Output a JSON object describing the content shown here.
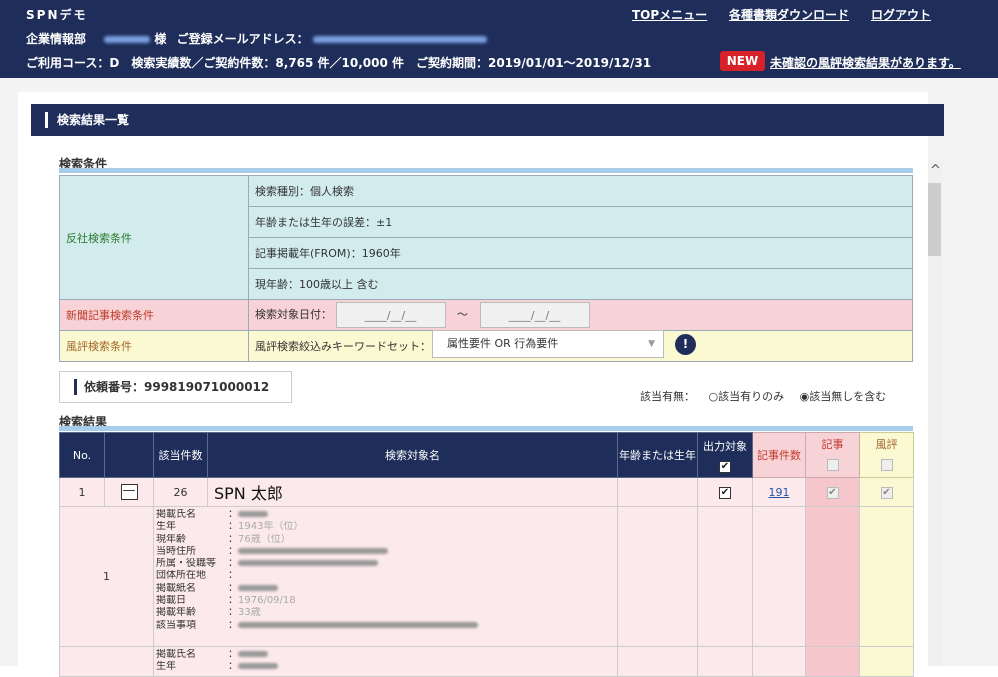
{
  "header": {
    "app_title": "SPNデモ",
    "nav": [
      "TOPメニュー",
      "各種書類ダウンロード",
      "ログアウト"
    ],
    "company_label": "企業情報部",
    "name_suffix": "様",
    "email_label": "ご登録メールアドレス：",
    "email_value": "kj-demo@sp-network.co.jp",
    "course_line": "ご利用コース：D　検索実績数／ご契約件数：8,765 件／10,000 件　ご契約期間：2019/01/01～2019/12/31",
    "new_badge": "NEW",
    "notice": "未確認の風評検索結果があります。"
  },
  "panel": {
    "title": "検索結果一覧"
  },
  "conditions": {
    "section": "検索条件",
    "anti_label": "反社検索条件",
    "anti_rows": [
      "検索種別：個人検索",
      "年齢または生年の誤差：±1",
      "記事掲載年(FROM)：1960年",
      "現年齢：100歳以上 含む"
    ],
    "news_label": "新聞記事検索条件",
    "news_date_label": "検索対象日付：",
    "date_placeholder": "____/__/__",
    "tilde": "～",
    "reputation_label": "風評検索条件",
    "keyword_label": "風評検索絞込みキーワードセット：",
    "keyword_value": "属性要件 OR 行為要件",
    "info_icon": "!"
  },
  "request": {
    "label": "依頼番号：999819071000012"
  },
  "filter": {
    "label": "該当有無：",
    "opt1": "○該当有りのみ",
    "opt2": "◉該当無しを含む"
  },
  "results": {
    "section": "検索結果",
    "headers": {
      "no": "No.",
      "count": "該当件数",
      "name": "検索対象名",
      "age": "年齢または生年",
      "output": "出力対象",
      "articles": "記事件数",
      "kiji": "記事",
      "fuhyo": "風評"
    },
    "row": {
      "no": "1",
      "count": "26",
      "name": "SPN 太郎",
      "articles": "191",
      "minus": "—"
    },
    "detail_no": "1",
    "detail_labels": [
      "掲載氏名",
      "生年",
      "現年齢",
      "当時住所",
      "所属・役職等",
      "団体所在地",
      "掲載紙名",
      "掲載日",
      "掲載年齢",
      "該当事項"
    ],
    "detail_visible_values": {
      "birth": "1943年（位）",
      "age": "76歳（位）",
      "date": "1976/09/18",
      "age2": "33歳"
    },
    "detail2_labels": [
      "掲載氏名",
      "生年"
    ]
  },
  "scroll": {
    "up_icon": "^"
  }
}
